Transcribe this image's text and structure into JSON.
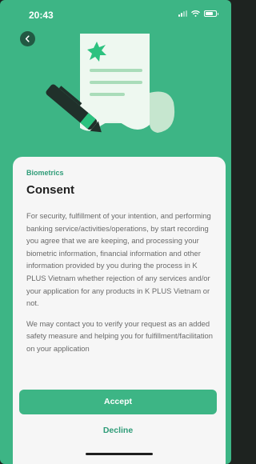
{
  "status_bar": {
    "time": "20:43",
    "icons": [
      "signal-icon",
      "wifi-icon",
      "battery-icon"
    ]
  },
  "header": {
    "back_icon": "chevron-left-icon",
    "illustration": "document-with-pen-illustration"
  },
  "sheet": {
    "eyebrow": "Biometrics",
    "title": "Consent",
    "paragraphs": [
      "For security, fulfillment of your intention, and performing banking service/activities/operations, by start recording you agree that we are keeping, and processing your biometric information, financial information and other information provided by you during the process in K PLUS Vietnam whether rejection of any services and/or your application for any products in K PLUS Vietnam or not.",
      "We may contact you to verify your request as an added safety measure and helping you for fulfillment/facilitation on your application"
    ],
    "accept_label": "Accept",
    "decline_label": "Decline"
  },
  "colors": {
    "brand_green": "#3db585",
    "accent_text_green": "#2f9c78",
    "sheet_background": "#f6f6f6",
    "title_text": "#1f1f1f",
    "body_text": "#6a6a6a"
  }
}
